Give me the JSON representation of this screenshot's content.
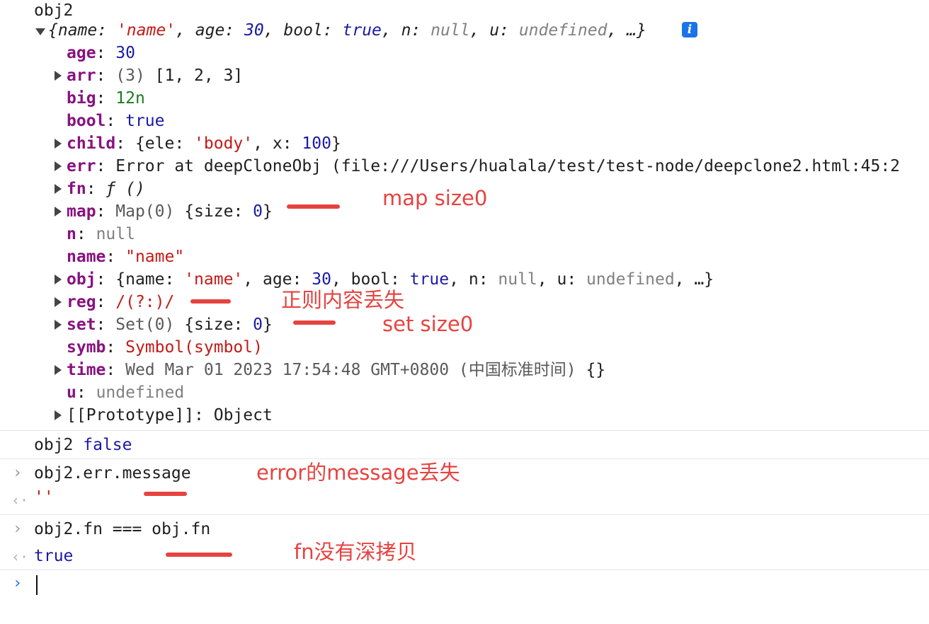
{
  "header_label": "obj2",
  "summary": {
    "open_brace": "{",
    "k_name": "name",
    "v_name": "'name'",
    "k_age": "age",
    "v_age": "30",
    "k_bool": "bool",
    "v_bool": "true",
    "k_n": "n",
    "v_n": "null",
    "k_u": "u",
    "v_u": "undefined",
    "ellipsis": "…}",
    "info": "i"
  },
  "props": {
    "age": {
      "key": "age",
      "value": "30"
    },
    "arr": {
      "key": "arr",
      "count": "(3)",
      "value": "[1, 2, 3]"
    },
    "big": {
      "key": "big",
      "value": "12n"
    },
    "bool": {
      "key": "bool",
      "value": "true"
    },
    "child": {
      "key": "child",
      "ele_key": "ele",
      "ele_val": "'body'",
      "x_key": "x",
      "x_val": "100"
    },
    "err": {
      "key": "err",
      "value": "Error at deepCloneObj (file:///Users/hualala/test/test-node/deepclone2.html:45:2"
    },
    "fn": {
      "key": "fn",
      "value": "ƒ ()"
    },
    "map": {
      "key": "map",
      "type": "Map(0)",
      "size_key": "size",
      "size_val": "0"
    },
    "n": {
      "key": "n",
      "value": "null"
    },
    "name": {
      "key": "name",
      "value": "\"name\""
    },
    "obj": {
      "key": "obj",
      "k_name": "name",
      "v_name": "'name'",
      "k_age": "age",
      "v_age": "30",
      "k_bool": "bool",
      "v_bool": "true",
      "k_n": "n",
      "v_n": "null",
      "k_u": "u",
      "v_u": "undefined",
      "ellipsis": "…}"
    },
    "reg": {
      "key": "reg",
      "value": "/(?:)/"
    },
    "set": {
      "key": "set",
      "type": "Set(0)",
      "size_key": "size",
      "size_val": "0"
    },
    "symb": {
      "key": "symb",
      "value": "Symbol(symbol)"
    },
    "time": {
      "key": "time",
      "value": "Wed Mar 01 2023 17:54:48 GMT+0800 (中国标准时间)",
      "tail": "{}"
    },
    "u": {
      "key": "u",
      "value": "undefined"
    },
    "proto": {
      "key": "[[Prototype]]",
      "value": "Object"
    }
  },
  "log2": {
    "label": "obj2",
    "value": "false"
  },
  "cmd1": {
    "input": "obj2.err.message",
    "output": "''"
  },
  "cmd2": {
    "input": "obj2.fn === obj.fn",
    "output": "true"
  },
  "annotations": {
    "map": "map size0",
    "reg": "正则内容丢失",
    "set": "set size0",
    "err": "error的message丢失",
    "fn": "fn没有深拷贝"
  },
  "colors": {
    "key": "#881280",
    "number": "#1a1aa6",
    "string": "#c41a16",
    "bigint": "#1e7b1e",
    "null": "#808080",
    "annotation": "#e64340",
    "prompt": "#1a73e8"
  },
  "icons": {
    "expand": "triangle-right-icon",
    "collapse": "triangle-down-icon",
    "info": "info-icon",
    "prompt": "chevron-right-icon",
    "result": "chevron-left-icon"
  }
}
